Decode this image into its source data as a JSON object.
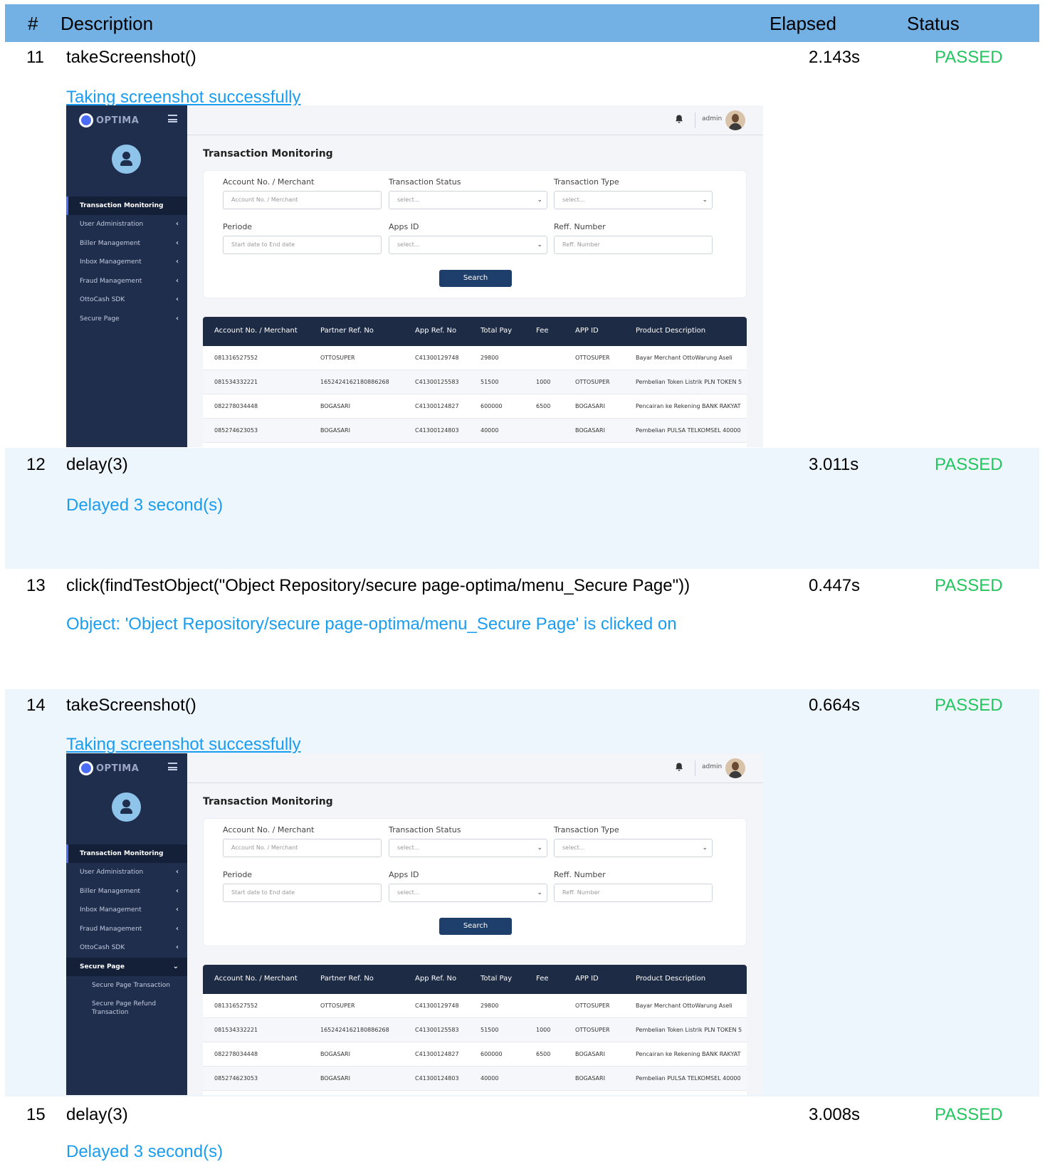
{
  "header": {
    "num": "#",
    "description": "Description",
    "elapsed": "Elapsed",
    "status": "Status"
  },
  "steps": [
    {
      "num": "11",
      "desc": "takeScreenshot()",
      "elapsed": "2.143s",
      "status": "PASSED",
      "message": "Taking screenshot successfully"
    },
    {
      "num": "12",
      "desc": "delay(3)",
      "elapsed": "3.011s",
      "status": "PASSED",
      "message": "Delayed 3 second(s)"
    },
    {
      "num": "13",
      "desc": "click(findTestObject(\"Object Repository/secure page-optima/menu_Secure Page\"))",
      "elapsed": "0.447s",
      "status": "PASSED",
      "message": "Object: 'Object Repository/secure page-optima/menu_Secure Page' is clicked on"
    },
    {
      "num": "14",
      "desc": "takeScreenshot()",
      "elapsed": "0.664s",
      "status": "PASSED",
      "message": "Taking screenshot successfully"
    },
    {
      "num": "15",
      "desc": "delay(3)",
      "elapsed": "3.008s",
      "status": "PASSED",
      "message": "Delayed 3 second(s)"
    }
  ],
  "app": {
    "logo": "OPTIMA",
    "admin": "admin",
    "page_title": "Transaction Monitoring",
    "menu": [
      "Transaction Monitoring",
      "User Administration",
      "Biller Management",
      "Inbox Management",
      "Fraud Management",
      "OttoCash SDK",
      "Secure Page"
    ],
    "submenu": [
      "Secure Page Transaction",
      "Secure Page Refund Transaction"
    ],
    "form": {
      "account_label": "Account No. / Merchant",
      "account_placeholder": "Account No. / Merchant",
      "status_label": "Transaction Status",
      "status_value": "select...",
      "type_label": "Transaction Type",
      "type_value": "select...",
      "periode_label": "Periode",
      "periode_placeholder": "Start date to End date",
      "apps_label": "Apps ID",
      "apps_value": "select...",
      "reff_label": "Reff. Number",
      "reff_placeholder": "Reff. Number",
      "search": "Search"
    },
    "table": {
      "headers": [
        "Account No. / Merchant",
        "Partner Ref. No",
        "App Ref. No",
        "Total Pay",
        "Fee",
        "APP ID",
        "Product Description"
      ],
      "rows": [
        [
          "081316527552",
          "OTTOSUPER",
          "C41300129748",
          "29800",
          "",
          "OTTOSUPER",
          "Bayar Merchant OttoWarung Aseli"
        ],
        [
          "081534332221",
          "1652424162180886268",
          "C41300125583",
          "51500",
          "1000",
          "OTTOSUPER",
          "Pembelian Token Listrik PLN TOKEN 5"
        ],
        [
          "082278034448",
          "BOGASARI",
          "C41300124827",
          "600000",
          "6500",
          "BOGASARI",
          "Pencairan ke Rekening BANK RAKYAT"
        ],
        [
          "085274623053",
          "BOGASARI",
          "C41300124803",
          "40000",
          "",
          "BOGASARI",
          "Pembelian PULSA TELKOMSEL 40000"
        ]
      ]
    }
  }
}
